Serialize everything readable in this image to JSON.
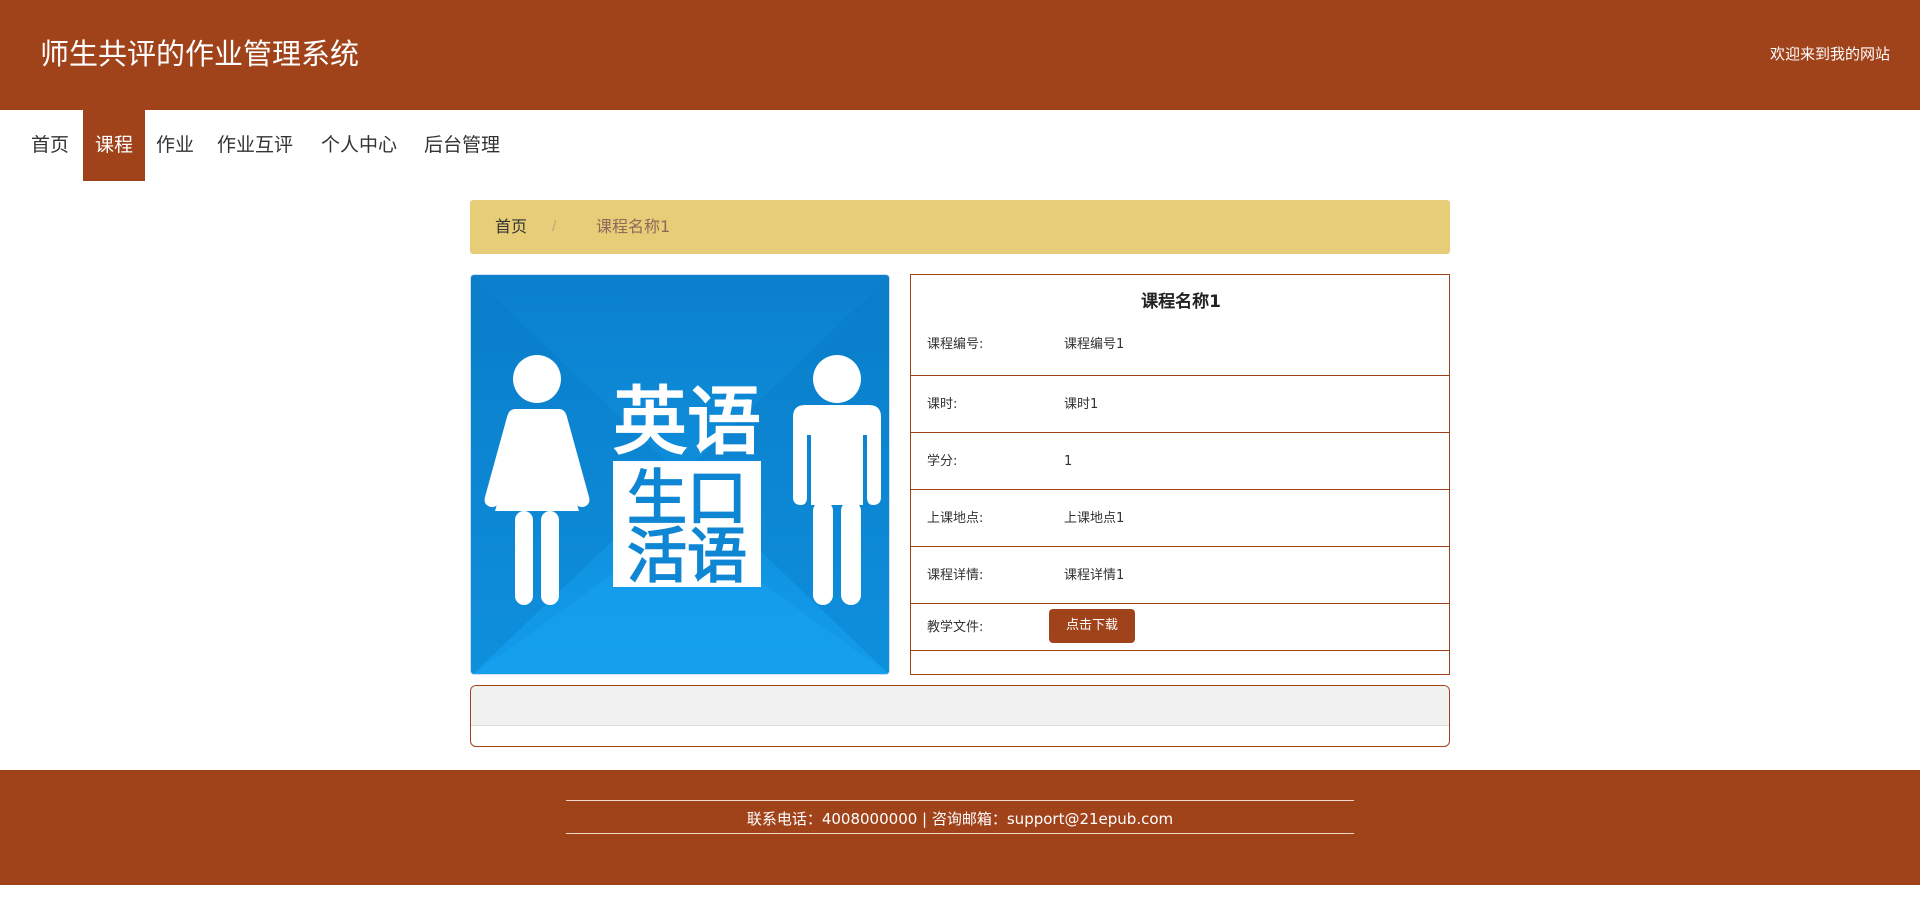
{
  "header": {
    "title": "师生共评的作业管理系统",
    "welcome": "欢迎来到我的网站"
  },
  "nav": {
    "items": [
      {
        "label": "首页"
      },
      {
        "label": "课程"
      },
      {
        "label": "作业"
      },
      {
        "label": "作业互评"
      },
      {
        "label": "个人中心"
      },
      {
        "label": "后台管理"
      }
    ],
    "active": "课程"
  },
  "breadcrumb": {
    "home": "首页",
    "separator": "/",
    "current": "课程名称1"
  },
  "course_image": {
    "text_top": "英语",
    "text_mid1": "生口",
    "text_mid2": "活语",
    "icon_left": "woman-icon",
    "icon_right": "man-icon"
  },
  "detail": {
    "title": "课程名称1",
    "rows": [
      {
        "label": "课程编号:",
        "value": "课程编号1"
      },
      {
        "label": "课时:",
        "value": "课时1"
      },
      {
        "label": "学分:",
        "value": "1"
      },
      {
        "label": "上课地点:",
        "value": "上课地点1"
      },
      {
        "label": "课程详情:",
        "value": "课程详情1"
      }
    ],
    "file_label": "教学文件:",
    "download_label": "点击下载"
  },
  "footer": {
    "text": "联系电话：4008000000 | 咨询邮箱：support@21epub.com"
  },
  "colors": {
    "primary": "#a0431b",
    "breadcrumb_bg": "#e8cd79",
    "image_blue": "#0f86d3"
  }
}
